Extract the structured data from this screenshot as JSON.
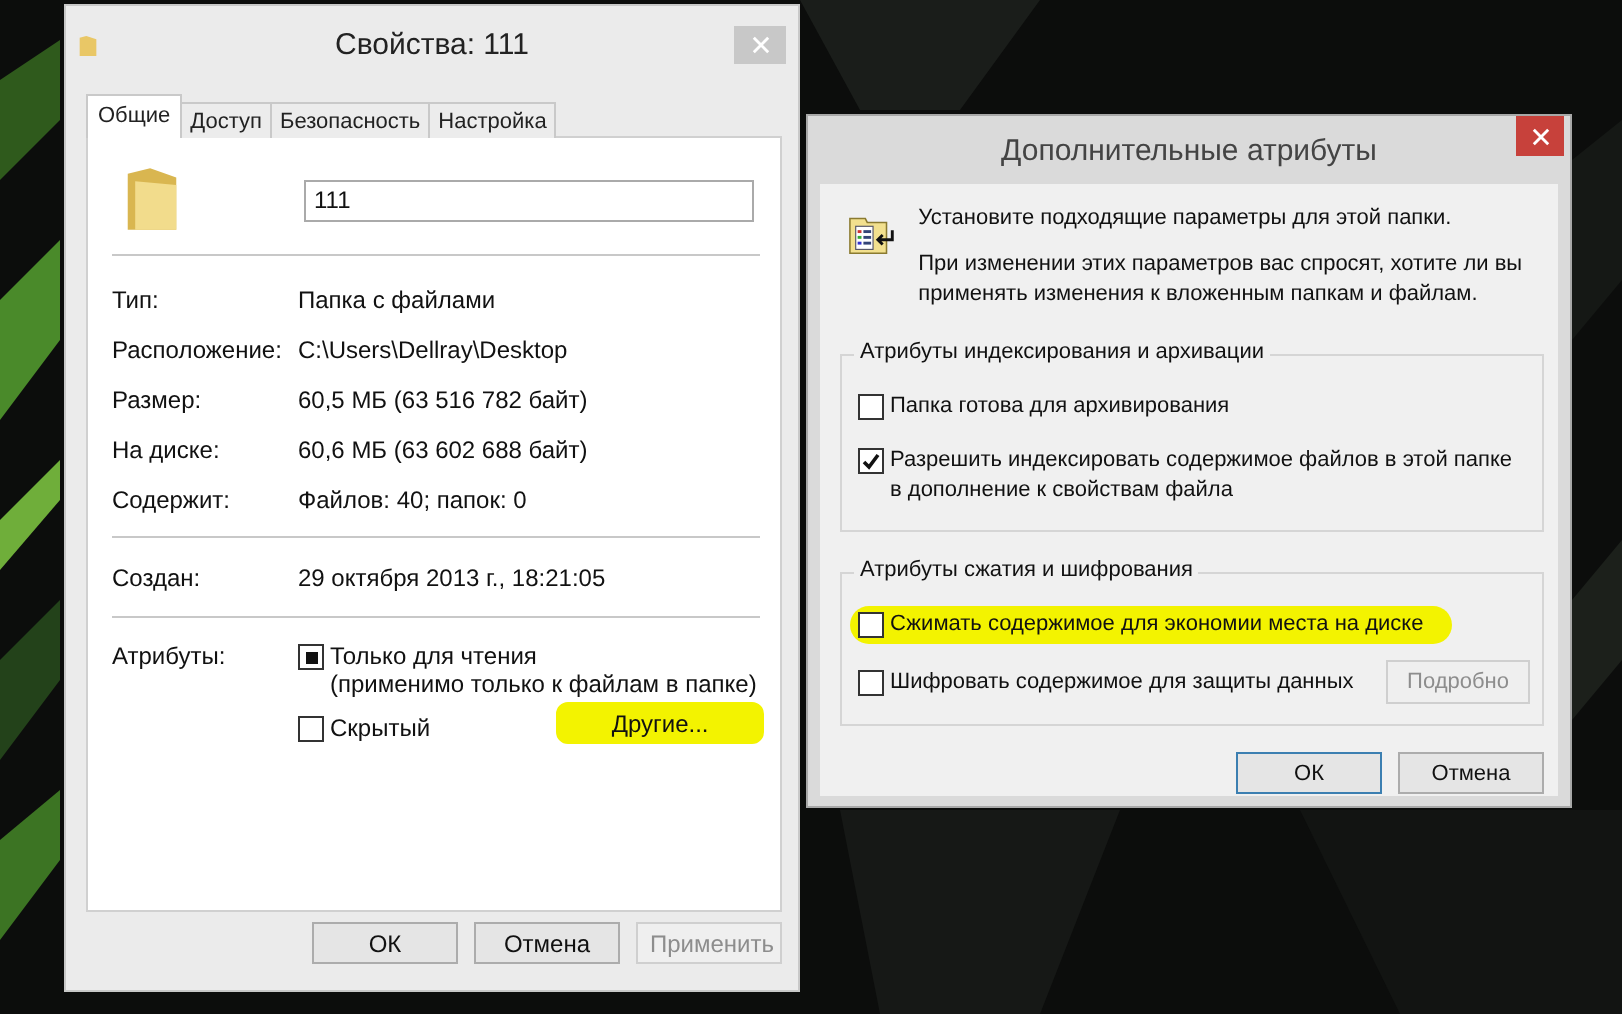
{
  "properties_window": {
    "title": "Свойства: 111",
    "active": false,
    "tabs": [
      {
        "label": "Общие",
        "selected": true
      },
      {
        "label": "Доступ",
        "selected": false
      },
      {
        "label": "Безопасность",
        "selected": false
      },
      {
        "label": "Настройка",
        "selected": false
      }
    ],
    "name_field": {
      "value": "111"
    },
    "info_rows": [
      {
        "label": "Тип:",
        "value": "Папка с файлами"
      },
      {
        "label": "Расположение:",
        "value": "C:\\Users\\Dellray\\Desktop"
      },
      {
        "label": "Размер:",
        "value": "60,5 МБ (63 516 782 байт)"
      },
      {
        "label": "На диске:",
        "value": "60,6 МБ (63 602 688 байт)"
      },
      {
        "label": "Содержит:",
        "value": "Файлов: 40; папок: 0"
      }
    ],
    "created": {
      "label": "Создан:",
      "value": "29 октября 2013 г., 18:21:05"
    },
    "attributes": {
      "label": "Атрибуты:",
      "items": [
        {
          "label": "Только для чтения",
          "note": "(применимо только к файлам в папке)",
          "mixed": true
        },
        {
          "label": "Скрытый",
          "mixed": false
        }
      ],
      "other_button": {
        "label": "Другие...",
        "highlighted": true
      }
    },
    "buttons": [
      {
        "label": "ОК",
        "disabled": false
      },
      {
        "label": "Отмена",
        "disabled": false
      },
      {
        "label": "Применить",
        "disabled": true
      }
    ]
  },
  "advanced_window": {
    "title": "Дополнительные атрибуты",
    "active": true,
    "intro": "Установите подходящие параметры для этой папки.",
    "note": "При изменении этих параметров вас спросят, хотите ли вы применять изменения к вложенным папкам и файлам.",
    "groups": [
      {
        "legend": "Атрибуты индексирования и архивации",
        "items": [
          {
            "label": "Папка готова для архивирования",
            "checked": false,
            "highlighted": false
          },
          {
            "label": "Разрешить индексировать содержимое файлов в этой папке в дополнение к свойствам файла",
            "checked": true,
            "highlighted": false
          }
        ]
      },
      {
        "legend": "Атрибуты сжатия и шифрования",
        "items": [
          {
            "label": "Сжимать содержимое для экономии места на диске",
            "checked": false,
            "highlighted": true
          },
          {
            "label": "Шифровать содержимое для защиты данных",
            "checked": false,
            "highlighted": false,
            "button": {
              "label": "Подробно",
              "disabled": true
            }
          }
        ]
      }
    ],
    "buttons": [
      {
        "label": "ОК",
        "default": true
      },
      {
        "label": "Отмена",
        "default": false
      }
    ]
  }
}
